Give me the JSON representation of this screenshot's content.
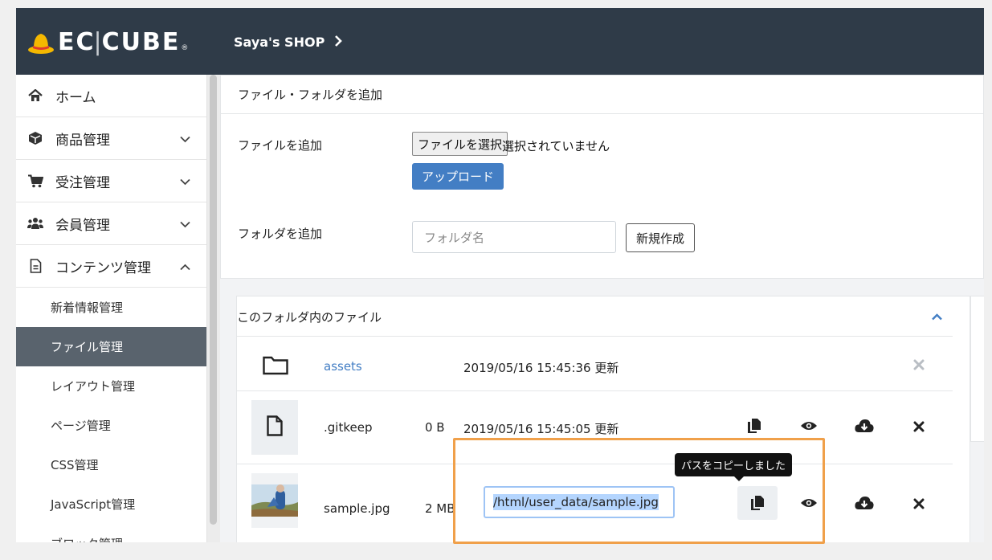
{
  "header": {
    "logo_text_a": "EC",
    "logo_text_b": "CUBE",
    "logo_reg": "®",
    "shop_name": "Saya's SHOP"
  },
  "sidebar": {
    "items": [
      {
        "label": "ホーム",
        "icon": "home-icon"
      },
      {
        "label": "商品管理",
        "icon": "cube-icon"
      },
      {
        "label": "受注管理",
        "icon": "cart-icon"
      },
      {
        "label": "会員管理",
        "icon": "users-icon"
      },
      {
        "label": "コンテンツ管理",
        "icon": "document-icon"
      }
    ],
    "sub_items": [
      "新着情報管理",
      "ファイル管理",
      "レイアウト管理",
      "ページ管理",
      "CSS管理",
      "JavaScript管理",
      "ブロック管理"
    ],
    "active_sub": "ファイル管理"
  },
  "add_card": {
    "title": "ファイル・フォルダを追加",
    "file_label": "ファイルを追加",
    "choose_button": "ファイルを選択",
    "no_file_text": "選択されていません",
    "upload_button": "アップロード",
    "folder_label": "フォルダを追加",
    "folder_placeholder": "フォルダ名",
    "create_button": "新規作成"
  },
  "files_card": {
    "title": "このフォルダ内のファイル",
    "rows": [
      {
        "name": "assets",
        "size": "",
        "updated": "2019/05/16 15:45:36 更新",
        "type": "folder"
      },
      {
        "name": ".gitkeep",
        "size": "0 B",
        "updated": "2019/05/16 15:45:05 更新",
        "type": "file"
      },
      {
        "name": "sample.jpg",
        "size": "2 MB",
        "path": "/html/user_data/sample.jpg",
        "type": "image"
      }
    ],
    "tooltip": "パスをコピーしました"
  },
  "colors": {
    "header_bg": "#2f3b48",
    "primary": "#437ec4",
    "active_nav": "#59636d",
    "highlight": "#f0a04a"
  }
}
